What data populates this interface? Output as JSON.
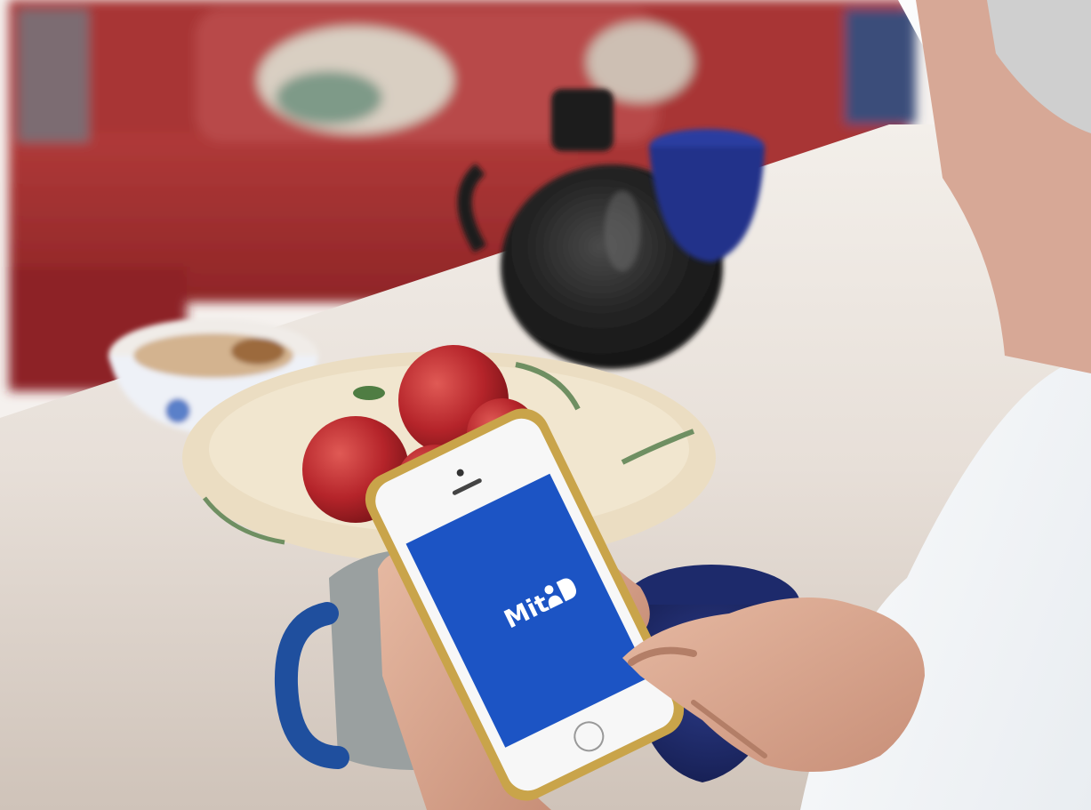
{
  "scene": {
    "subject": "hands-holding-smartphone",
    "colors": {
      "app_background": "#1c54c4",
      "app_text": "#ffffff",
      "sofa": "#9e2a2c",
      "table": "#e9e2dc",
      "apple": "#b5242a",
      "mug_handle": "#1f4f9e",
      "bowl_navy": "#1d2a6b",
      "jug": "#222222",
      "phone_frame": "#c9a44a"
    }
  },
  "phone_screen": {
    "logo_text": "Mit",
    "logo_icon": "mitid-person-d-icon"
  }
}
